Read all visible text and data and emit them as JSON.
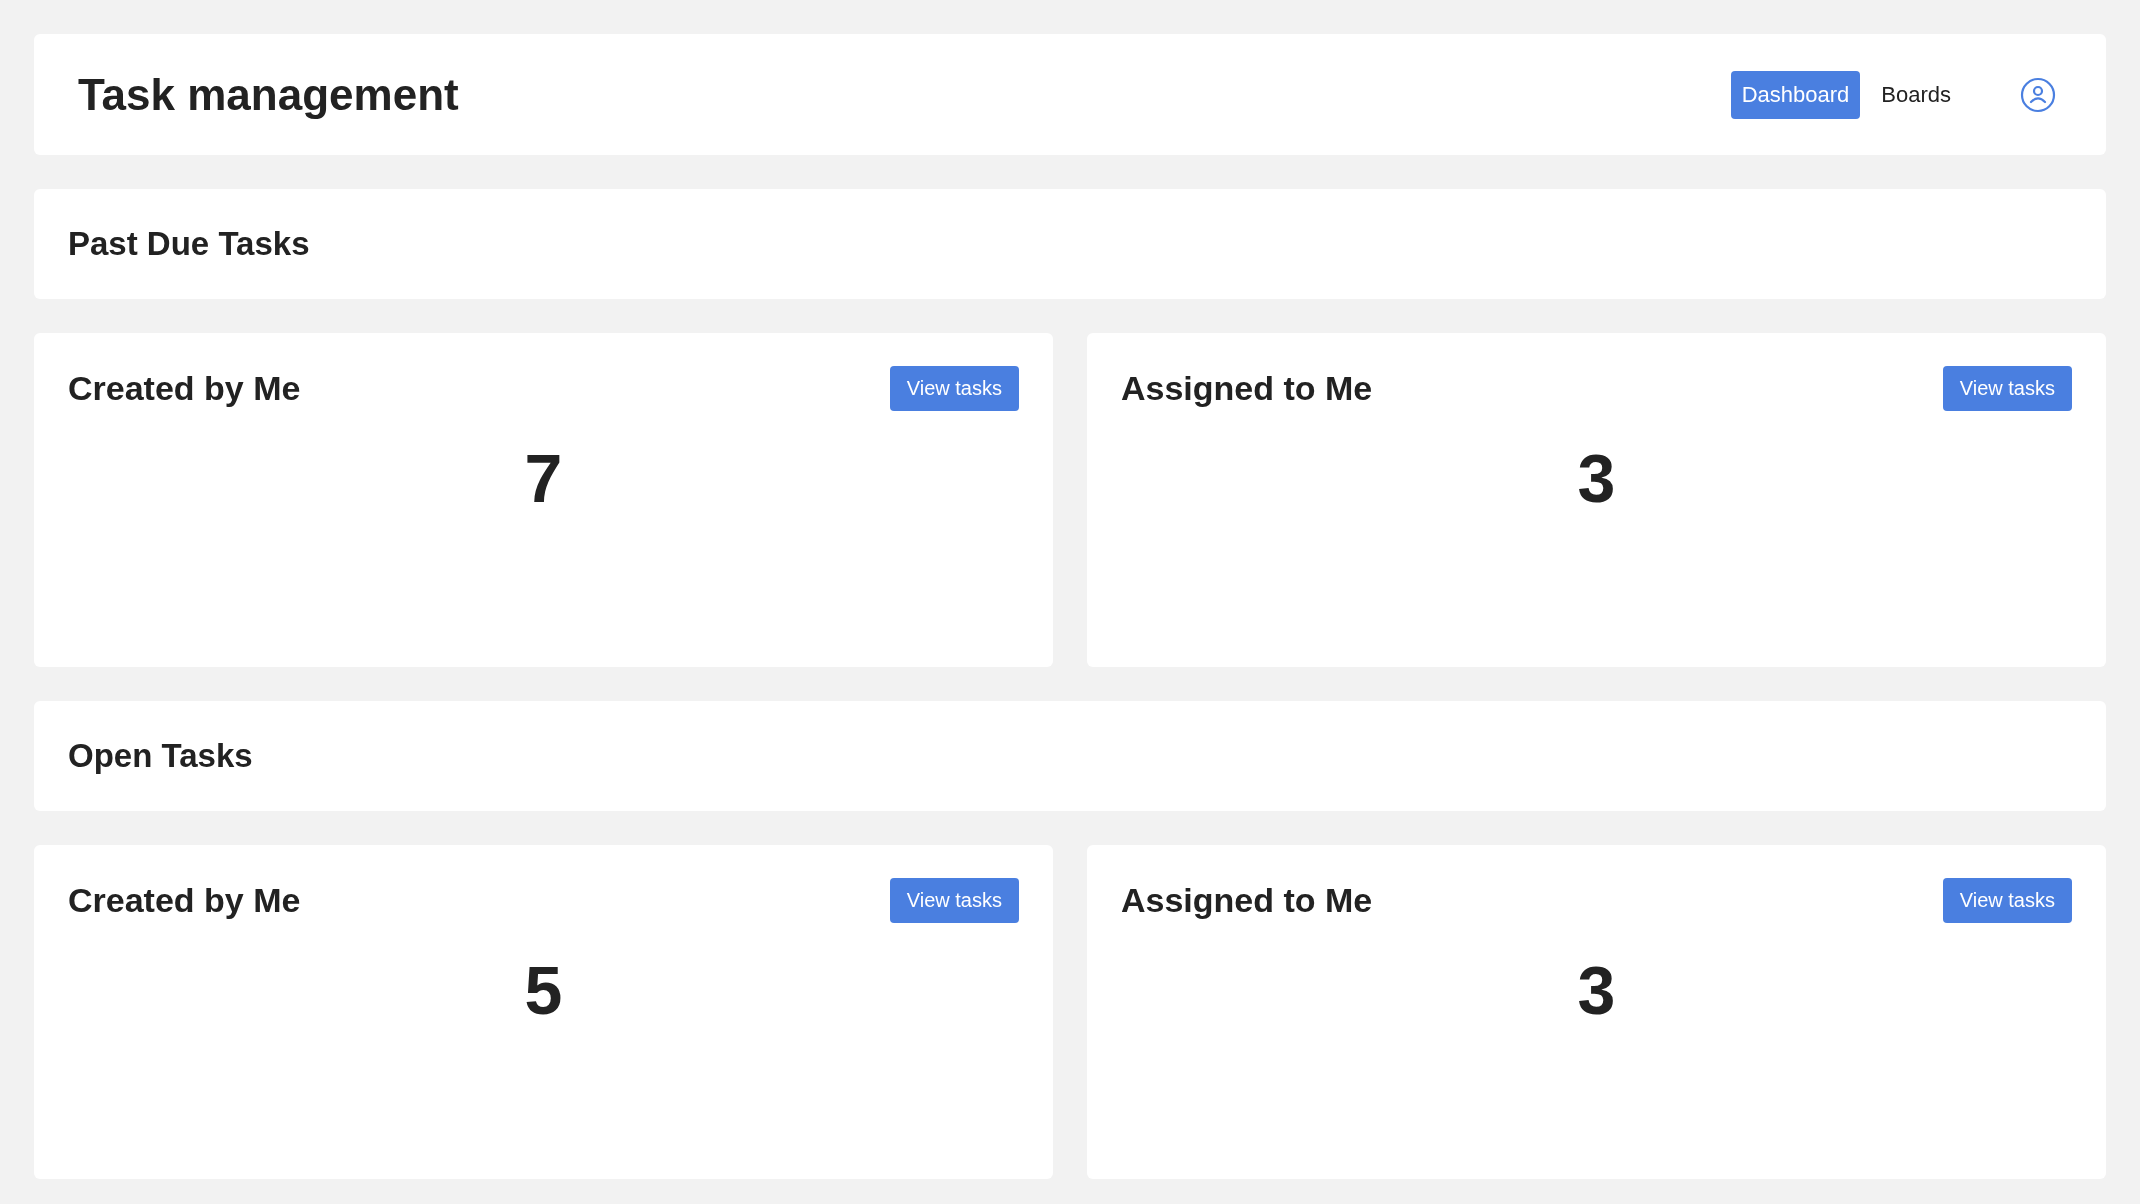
{
  "header": {
    "title": "Task management",
    "nav": [
      {
        "label": "Dashboard",
        "selected": true
      },
      {
        "label": "Boards",
        "selected": false
      }
    ]
  },
  "sections": [
    {
      "title": "Past Due Tasks",
      "cards": [
        {
          "title": "Created by Me",
          "button": "View tasks",
          "count": "7"
        },
        {
          "title": "Assigned to Me",
          "button": "View tasks",
          "count": "3"
        }
      ]
    },
    {
      "title": "Open Tasks",
      "cards": [
        {
          "title": "Created by Me",
          "button": "View tasks",
          "count": "5"
        },
        {
          "title": "Assigned to Me",
          "button": "View tasks",
          "count": "3"
        }
      ]
    }
  ]
}
